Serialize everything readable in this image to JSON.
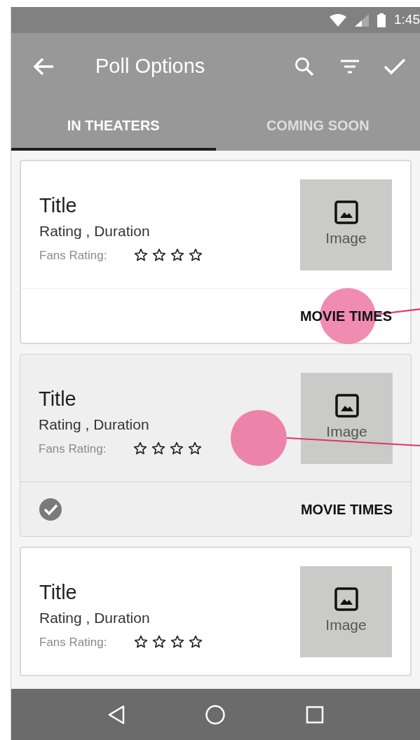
{
  "status_bar": {
    "time": "1:45"
  },
  "app_bar": {
    "title": "Poll Options"
  },
  "tabs": [
    {
      "label": "IN THEATERS",
      "selected": true
    },
    {
      "label": "COMING SOON",
      "selected": false
    }
  ],
  "cards": [
    {
      "title": "Title",
      "subtitle": "Rating , Duration",
      "fans_label": "Fans Rating:",
      "stars": 0,
      "image_label": "Image",
      "action": "MOVIE TIMES",
      "selected": false
    },
    {
      "title": "Title",
      "subtitle": "Rating , Duration",
      "fans_label": "Fans Rating:",
      "stars": 0,
      "image_label": "Image",
      "action": "MOVIE TIMES",
      "selected": true
    },
    {
      "title": "Title",
      "subtitle": "Rating , Duration",
      "fans_label": "Fans Rating:",
      "stars": 0,
      "image_label": "Image",
      "selected": false
    }
  ]
}
